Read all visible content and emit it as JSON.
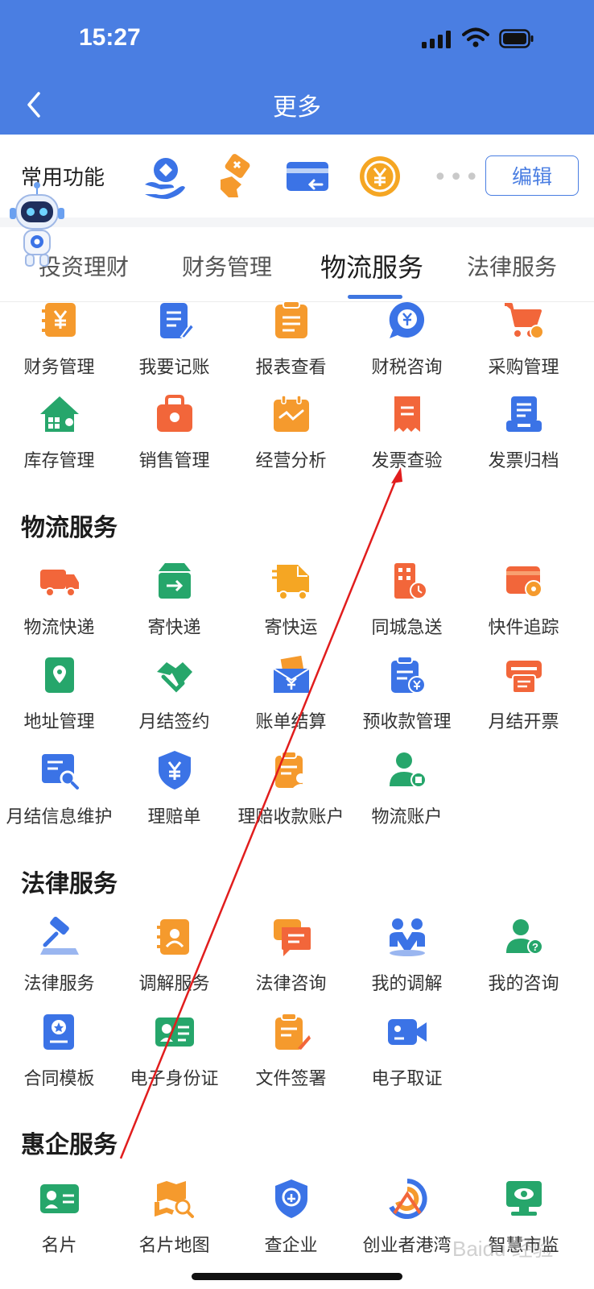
{
  "status_bar": {
    "time": "15:27"
  },
  "header": {
    "title": "更多"
  },
  "common": {
    "label": "常用功能",
    "edit_label": "编辑",
    "icons": [
      "hand-user-icon",
      "hand-ticket-icon",
      "card-return-icon",
      "yuan-coin-icon"
    ],
    "more": "•••"
  },
  "tabs": [
    {
      "label": "投资理财"
    },
    {
      "label": "财务管理"
    },
    {
      "label": "物流服务",
      "active": true
    },
    {
      "label": "法律服务"
    }
  ],
  "finance_items": [
    {
      "label": "财务管理",
      "icon": "finance-icon"
    },
    {
      "label": "我要记账",
      "icon": "bookkeeping-icon"
    },
    {
      "label": "报表查看",
      "icon": "report-icon"
    },
    {
      "label": "财税咨询",
      "icon": "tax-consult-icon"
    },
    {
      "label": "采购管理",
      "icon": "purchase-cart-icon"
    },
    {
      "label": "库存管理",
      "icon": "inventory-icon"
    },
    {
      "label": "销售管理",
      "icon": "sales-icon"
    },
    {
      "label": "经营分析",
      "icon": "analysis-icon"
    },
    {
      "label": "发票查验",
      "icon": "invoice-check-icon"
    },
    {
      "label": "发票归档",
      "icon": "invoice-archive-icon"
    }
  ],
  "logistics": {
    "title": "物流服务",
    "items": [
      {
        "label": "物流快递",
        "icon": "truck-icon"
      },
      {
        "label": "寄快递",
        "icon": "parcel-box-icon"
      },
      {
        "label": "寄快运",
        "icon": "freight-truck-icon"
      },
      {
        "label": "同城急送",
        "icon": "city-delivery-icon"
      },
      {
        "label": "快件追踪",
        "icon": "tracking-icon"
      },
      {
        "label": "地址管理",
        "icon": "address-book-icon"
      },
      {
        "label": "月结签约",
        "icon": "handshake-icon"
      },
      {
        "label": "账单结算",
        "icon": "bill-settle-icon"
      },
      {
        "label": "预收款管理",
        "icon": "prepayment-icon"
      },
      {
        "label": "月结开票",
        "icon": "printer-icon"
      },
      {
        "label": "月结信息维护",
        "icon": "info-search-icon"
      },
      {
        "label": "理赔单",
        "icon": "shield-yuan-icon"
      },
      {
        "label": "理赔收款账户",
        "icon": "claim-account-icon"
      },
      {
        "label": "物流账户",
        "icon": "logistics-account-icon"
      }
    ]
  },
  "legal": {
    "title": "法律服务",
    "items": [
      {
        "label": "法律服务",
        "icon": "gavel-icon"
      },
      {
        "label": "调解服务",
        "icon": "mediation-icon"
      },
      {
        "label": "法律咨询",
        "icon": "chat-bubble-icon"
      },
      {
        "label": "我的调解",
        "icon": "people-icon"
      },
      {
        "label": "我的咨询",
        "icon": "user-question-icon"
      },
      {
        "label": "合同模板",
        "icon": "contract-icon"
      },
      {
        "label": "电子身份证",
        "icon": "id-card-icon"
      },
      {
        "label": "文件签署",
        "icon": "document-sign-icon"
      },
      {
        "label": "电子取证",
        "icon": "video-camera-icon"
      }
    ]
  },
  "enterprise": {
    "title": "惠企服务",
    "items": [
      {
        "label": "名片",
        "icon": "business-card-icon"
      },
      {
        "label": "名片地图",
        "icon": "map-search-icon"
      },
      {
        "label": "查企业",
        "icon": "enterprise-shield-icon"
      },
      {
        "label": "创业者港湾",
        "icon": "harbor-logo-icon"
      },
      {
        "label": "智慧市监",
        "icon": "monitor-eye-icon"
      }
    ]
  },
  "watermark": "Baidu 经验",
  "colors": {
    "header": "#4a7ee2",
    "accent": "#3f76e0",
    "orange": "#f59a2d",
    "green": "#26a66b",
    "red_orange": "#f2663a",
    "blue": "#3b73e6"
  }
}
